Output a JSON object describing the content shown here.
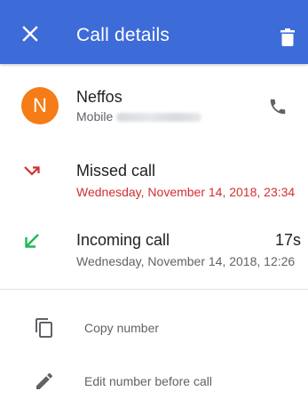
{
  "appbar": {
    "title": "Call details",
    "close_icon": "close-icon",
    "delete_icon": "trash-icon",
    "color": "#3d6bd8"
  },
  "contact": {
    "avatar_letter": "N",
    "avatar_color": "#f57c17",
    "name": "Neffos",
    "number_type": "Mobile",
    "call_icon": "phone-icon"
  },
  "calls": [
    {
      "type": "Missed call",
      "datetime": "Wednesday, November 14, 2018, 23:34",
      "icon": "missed-call-icon",
      "color": "#d32f2f",
      "duration": ""
    },
    {
      "type": "Incoming call",
      "datetime": "Wednesday, November 14, 2018, 12:26",
      "icon": "incoming-call-icon",
      "color": "#1db954",
      "duration": "17s"
    }
  ],
  "actions": [
    {
      "label": "Copy number",
      "icon": "copy-icon"
    },
    {
      "label": "Edit number before call",
      "icon": "pencil-icon"
    }
  ]
}
